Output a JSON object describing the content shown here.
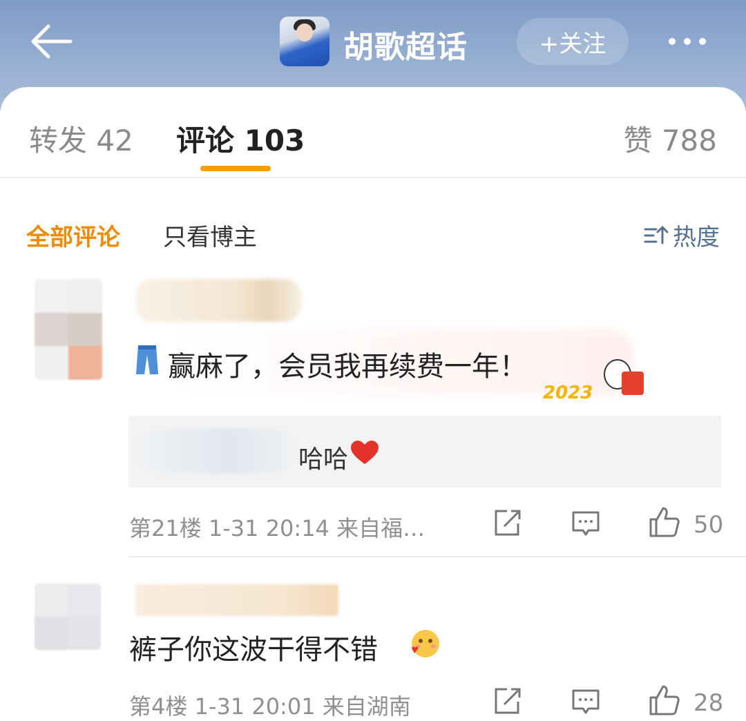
{
  "header": {
    "title": "胡歌超话",
    "follow_label": "+关注",
    "back_icon": "arrow-left-icon",
    "more_icon": "more-dots-icon"
  },
  "tabs": {
    "repost": "转发 42",
    "comment": "评论 103",
    "like": "赞 788",
    "active_color": "#f5a000"
  },
  "filters": {
    "all": "全部评论",
    "owner_only": "只看博主",
    "sort": "热度"
  },
  "comments": [
    {
      "text": "赢麻了，会员我再续费一年！",
      "badge": "2023",
      "reply": "哈哈",
      "meta": "第21楼  1-31 20:14  来自福…",
      "likes": "50"
    },
    {
      "text": "裤子你这波干得不错",
      "meta": "第4楼  1-31 20:01  来自湖南",
      "likes": "28"
    }
  ],
  "colors": {
    "header_gradient_top": "#7f9cc6",
    "accent_orange": "#f08a00",
    "sort_blue": "#56708f"
  }
}
